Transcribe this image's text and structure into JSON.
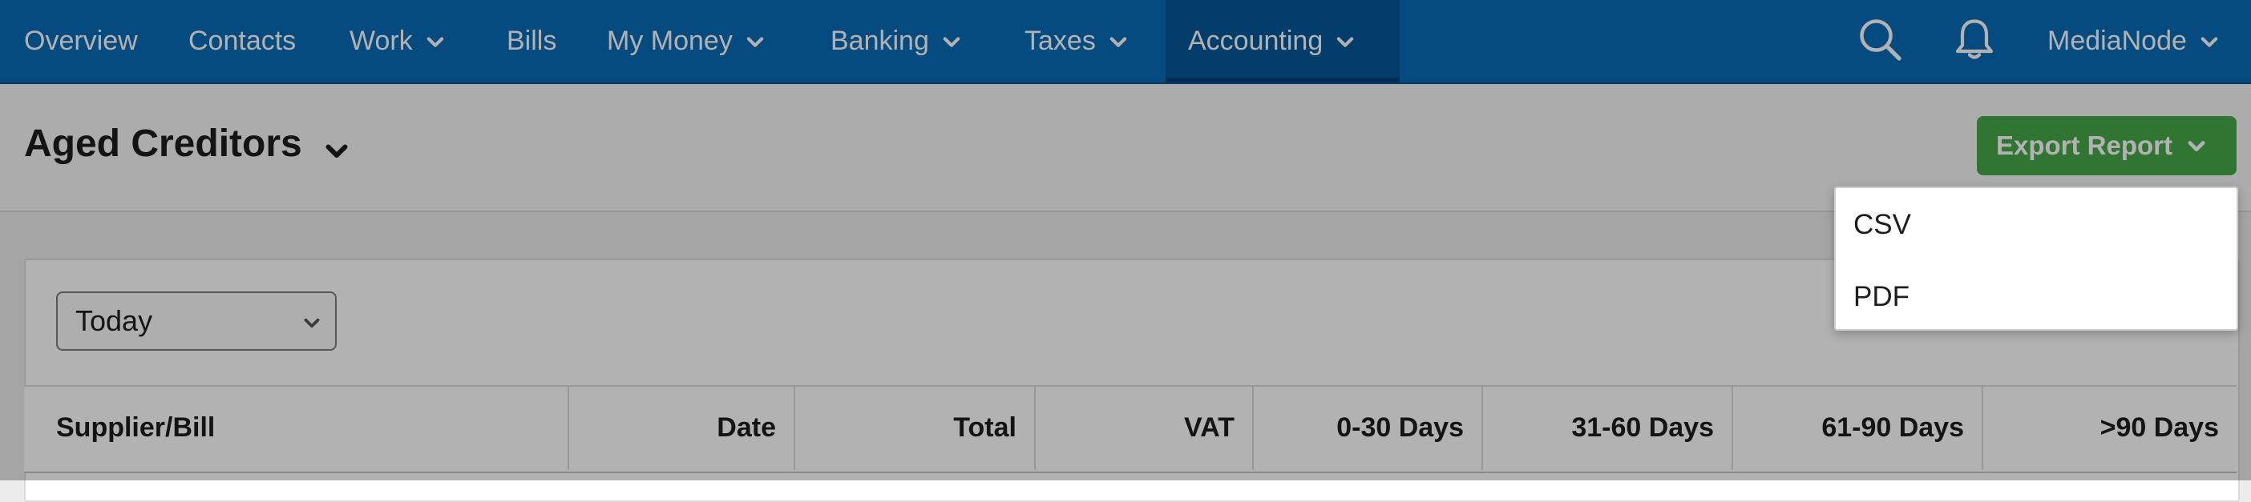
{
  "nav": {
    "items": [
      {
        "label": "Overview",
        "has_chevron": false
      },
      {
        "label": "Contacts",
        "has_chevron": false
      },
      {
        "label": "Work",
        "has_chevron": true
      },
      {
        "label": "Bills",
        "has_chevron": false
      },
      {
        "label": "My Money",
        "has_chevron": true
      },
      {
        "label": "Banking",
        "has_chevron": true
      },
      {
        "label": "Taxes",
        "has_chevron": true
      },
      {
        "label": "Accounting",
        "has_chevron": true,
        "active": true
      }
    ],
    "account_label": "MediaNode",
    "icons": [
      "search-icon",
      "bell-icon"
    ]
  },
  "page": {
    "title": "Aged Creditors",
    "export_label": "Export Report"
  },
  "export_menu": {
    "items": [
      "CSV",
      "PDF"
    ]
  },
  "filter": {
    "period_value": "Today"
  },
  "table": {
    "columns": [
      "Supplier/Bill",
      "Date",
      "Total",
      "VAT",
      "0-30 Days",
      "31-60 Days",
      "61-90 Days",
      ">90 Days"
    ]
  },
  "colors": {
    "nav_bg": "#0a6cb8",
    "export_button": "#47a84a",
    "overlay": "rgba(0,0,0,0.30)"
  }
}
